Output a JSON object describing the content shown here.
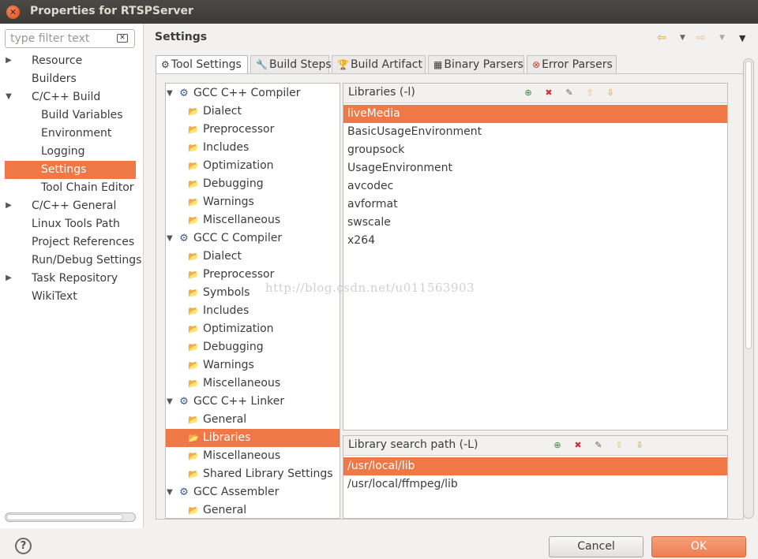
{
  "window": {
    "title": "Properties for RTSPServer"
  },
  "filter": {
    "placeholder": "type filter text"
  },
  "nav": [
    {
      "label": "Resource",
      "arrow": "▶"
    },
    {
      "label": "Builders",
      "arrow": ""
    },
    {
      "label": "C/C++ Build",
      "arrow": "▼"
    },
    {
      "label": "Build Variables",
      "arrow": ""
    },
    {
      "label": "Environment",
      "arrow": ""
    },
    {
      "label": "Logging",
      "arrow": ""
    },
    {
      "label": "Settings",
      "arrow": ""
    },
    {
      "label": "Tool Chain Editor",
      "arrow": ""
    },
    {
      "label": "C/C++ General",
      "arrow": "▶"
    },
    {
      "label": "Linux Tools Path",
      "arrow": ""
    },
    {
      "label": "Project References",
      "arrow": ""
    },
    {
      "label": "Run/Debug Settings",
      "arrow": ""
    },
    {
      "label": "Task Repository",
      "arrow": "▶"
    },
    {
      "label": "WikiText",
      "arrow": ""
    }
  ],
  "page_title": "Settings",
  "tabs": [
    {
      "label": "Tool Settings",
      "icon": "⚙"
    },
    {
      "label": "Build Steps",
      "icon": "🔧"
    },
    {
      "label": "Build Artifact",
      "icon": "🏆"
    },
    {
      "label": "Binary Parsers",
      "icon": "▦"
    },
    {
      "label": "Error Parsers",
      "icon": "⊗"
    }
  ],
  "tree": [
    {
      "label": "GCC C++ Compiler",
      "type": "tool"
    },
    {
      "label": "Dialect",
      "type": "option"
    },
    {
      "label": "Preprocessor",
      "type": "option"
    },
    {
      "label": "Includes",
      "type": "option"
    },
    {
      "label": "Optimization",
      "type": "option"
    },
    {
      "label": "Debugging",
      "type": "option"
    },
    {
      "label": "Warnings",
      "type": "option"
    },
    {
      "label": "Miscellaneous",
      "type": "option"
    },
    {
      "label": "GCC C Compiler",
      "type": "tool"
    },
    {
      "label": "Dialect",
      "type": "option"
    },
    {
      "label": "Preprocessor",
      "type": "option"
    },
    {
      "label": "Symbols",
      "type": "option"
    },
    {
      "label": "Includes",
      "type": "option"
    },
    {
      "label": "Optimization",
      "type": "option"
    },
    {
      "label": "Debugging",
      "type": "option"
    },
    {
      "label": "Warnings",
      "type": "option"
    },
    {
      "label": "Miscellaneous",
      "type": "option"
    },
    {
      "label": "GCC C++ Linker",
      "type": "tool"
    },
    {
      "label": "General",
      "type": "option"
    },
    {
      "label": "Libraries",
      "type": "option"
    },
    {
      "label": "Miscellaneous",
      "type": "option"
    },
    {
      "label": "Shared Library Settings",
      "type": "option"
    },
    {
      "label": "GCC Assembler",
      "type": "tool"
    },
    {
      "label": "General",
      "type": "option"
    }
  ],
  "libraries": {
    "title": "Libraries (-l)",
    "items": [
      "liveMedia",
      "BasicUsageEnvironment",
      "groupsock",
      "UsageEnvironment",
      "avcodec",
      "avformat",
      "swscale",
      "x264"
    ]
  },
  "search_path": {
    "title": "Library search path (-L)",
    "items": [
      "/usr/local/lib",
      "/usr/local/ffmpeg/lib"
    ]
  },
  "watermark": "http://blog.csdn.net/u011563903",
  "buttons": {
    "help": "?",
    "cancel": "Cancel",
    "ok": "OK"
  },
  "colors": {
    "selection": "#f07746",
    "titlebar": "#3c3b37"
  }
}
